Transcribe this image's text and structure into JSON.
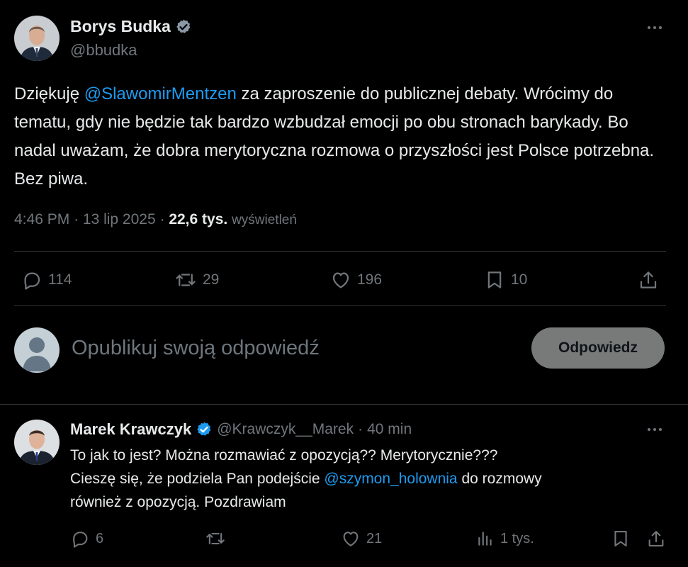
{
  "tweet": {
    "author_name": "Borys Budka",
    "author_handle": "@bbudka",
    "text_1": "Dziękuję ",
    "mention": "@SlawomirMentzen",
    "text_2": " za zaproszenie do publicznej debaty. Wrócimy do tematu, gdy nie będzie tak bardzo wzbudzał emocji po obu stronach barykady. Bo nadal uważam, że dobra merytoryczna rozmowa o przyszłości jest Polsce potrzebna. Bez piwa.",
    "time": "4:46 PM",
    "date": "13 lip 2025",
    "views_count": "22,6 tys.",
    "views_label": "wyświetleń",
    "replies": "114",
    "reposts": "29",
    "likes": "196",
    "bookmarks": "10"
  },
  "composer": {
    "placeholder": "Opublikuj swoją odpowiedź",
    "button": "Odpowiedz"
  },
  "reply": {
    "author_name": "Marek Krawczyk",
    "author_handle": "@Krawczyk__Marek",
    "time": "40 min",
    "line_1": "To jak to jest? Można rozmawiać z opozycją?? Merytorycznie???",
    "line_2_a": "Cieszę się, że podziela Pan podejście ",
    "mention": "@szymon_holownia",
    "line_2_b": " do rozmowy",
    "line_3": "również z opozycją. Pozdrawiam",
    "replies": "6",
    "reposts": "",
    "likes": "21",
    "views": "1 tys."
  },
  "colors": {
    "background": "#000000",
    "text": "#e7e9ea",
    "muted": "#71767b",
    "link": "#1d9bf0",
    "divider": "#2f3336",
    "button_bg": "#787a7a"
  },
  "icons": [
    "verified-badge-icon",
    "more-icon",
    "reply-icon",
    "repost-icon",
    "like-icon",
    "bookmark-icon",
    "share-icon",
    "views-icon",
    "default-avatar-icon"
  ]
}
